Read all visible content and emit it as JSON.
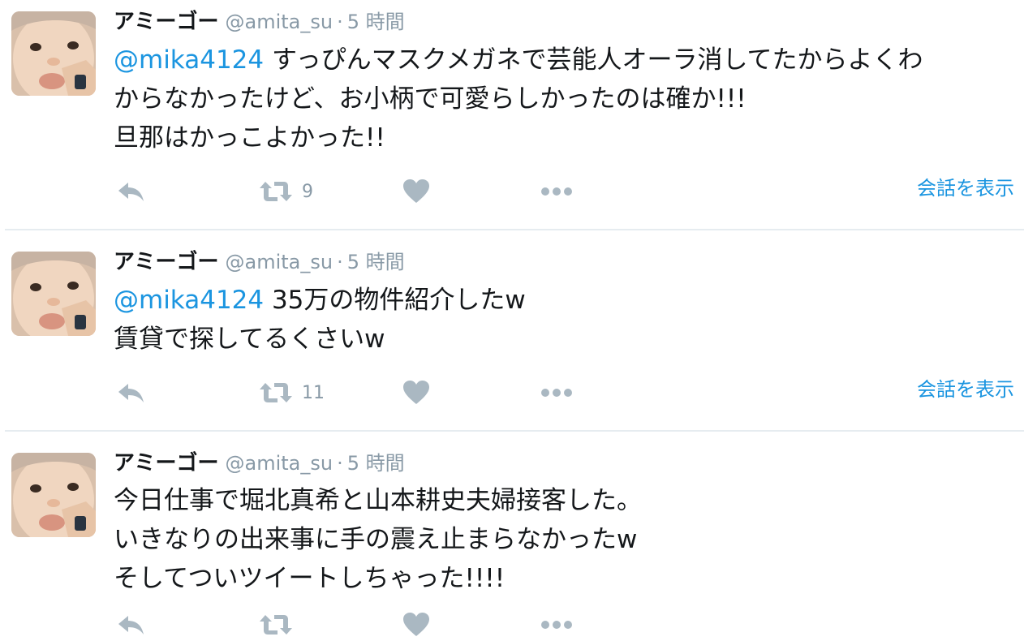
{
  "colors": {
    "link": "#1b95e0",
    "text": "#14171a",
    "muted": "#8899a6",
    "icon": "#aab8c2",
    "divider": "#e6ecf0"
  },
  "tweets": [
    {
      "fullname": "アミーゴー",
      "username": "@amita_su",
      "separator": "·",
      "time": "5 時間",
      "mention": "@mika4124",
      "lines": [
        " すっぴんマスクメガネで芸能人オーラ消してたからよくわ",
        "からなかったけど、お小柄で可愛らしかったのは確か!!!",
        "旦那はかっこよかった!!"
      ],
      "retweet_count": "9",
      "conversation_label": "会話を表示",
      "icons": [
        "reply-icon",
        "retweet-icon",
        "heart-icon",
        "more-icon"
      ]
    },
    {
      "fullname": "アミーゴー",
      "username": "@amita_su",
      "separator": "·",
      "time": "5 時間",
      "mention": "@mika4124",
      "lines": [
        " 35万の物件紹介したw",
        "賃貸で探してるくさいw"
      ],
      "retweet_count": "11",
      "conversation_label": "会話を表示",
      "icons": [
        "reply-icon",
        "retweet-icon",
        "heart-icon",
        "more-icon"
      ]
    },
    {
      "fullname": "アミーゴー",
      "username": "@amita_su",
      "separator": "·",
      "time": "5 時間",
      "lines": [
        "今日仕事で堀北真希と山本耕史夫婦接客した。",
        "いきなりの出来事に手の震え止まらなかったw",
        "そしてついツイートしちゃった!!!!"
      ],
      "icons": [
        "reply-icon",
        "retweet-icon",
        "heart-icon",
        "more-icon"
      ]
    }
  ]
}
